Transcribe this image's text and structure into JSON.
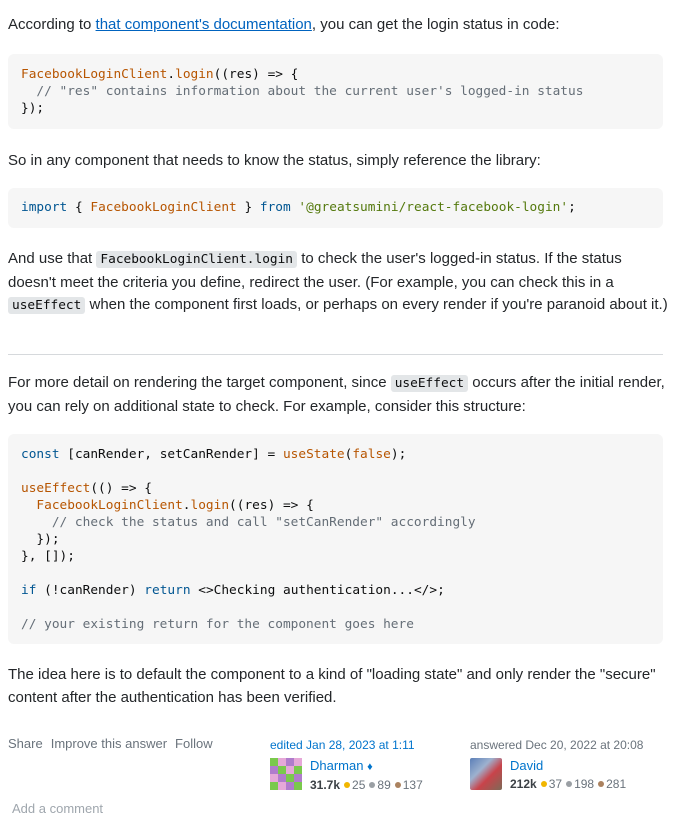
{
  "intro": {
    "before": "According to ",
    "link": "that component's documentation",
    "after": ", you can get the login status in code:"
  },
  "code1": {
    "l1a": "FacebookLoginClient",
    "l1b": ".",
    "l1c": "login",
    "l1d": "((res) => {",
    "l2": "  // \"res\" contains information about the current user's logged-in status",
    "l3": "});"
  },
  "para2": "So in any component that needs to know the status, simply reference the library:",
  "code2": {
    "kw_import": "import",
    "brace_open": " { ",
    "name": "FacebookLoginClient",
    "brace_close": " } ",
    "kw_from": "from",
    "space": " ",
    "str": "'@greatsumini/react-facebook-login'",
    "semi": ";"
  },
  "para3": {
    "t1": "And use that ",
    "code1": "FacebookLoginClient.login",
    "t2": " to check the user's logged-in status. If the status doesn't meet the criteria you define, redirect the user. (For example, you can check this in a ",
    "code2": "useEffect",
    "t3": " when the component first loads, or perhaps on every render if you're paranoid about it.)"
  },
  "para4": {
    "t1": "For more detail on rendering the target component, since ",
    "code1": "useEffect",
    "t2": " occurs after the initial render, you can rely on additional state to check. For example, consider this structure:"
  },
  "code3": {
    "l1_kw": "const",
    "l1_a": " [canRender, setCanRender] = ",
    "l1_fn": "useState",
    "l1_b": "(",
    "l1_lit": "false",
    "l1_c": ");",
    "l3_fn": "useEffect",
    "l3_a": "(() => {",
    "l4_fn1": "  FacebookLoginClient",
    "l4_dot": ".",
    "l4_fn2": "login",
    "l4_a": "((res) => {",
    "l5": "    // check the status and call \"setCanRender\" accordingly",
    "l6": "  });",
    "l7": "}, []);",
    "l9_kw": "if",
    "l9_a": " (!canRender) ",
    "l9_kw2": "return",
    "l9_b": " <>Checking authentication...</>;",
    "l11": "// your existing return for the component goes here"
  },
  "para5": "The idea here is to default the component to a kind of \"loading state\" and only render the \"secure\" content after the authentication has been verified.",
  "menu": {
    "share": "Share",
    "improve": "Improve this answer",
    "follow": "Follow"
  },
  "editor": {
    "action": "edited Jan 28, 2023 at 1:11",
    "name": "Dharman",
    "mod_icon": "diamond-icon",
    "rep": "31.7k",
    "gold": "25",
    "silver": "89",
    "bronze": "137"
  },
  "author": {
    "action": "answered Dec 20, 2022 at 20:08",
    "name": "David",
    "rep": "212k",
    "gold": "37",
    "silver": "198",
    "bronze": "281"
  },
  "add_comment": "Add a comment",
  "colors": {
    "link": "#0063bf",
    "gold": "#f1b600",
    "silver": "#9a9fa4",
    "bronze": "#ab825f",
    "user_link": "#0074cc"
  }
}
